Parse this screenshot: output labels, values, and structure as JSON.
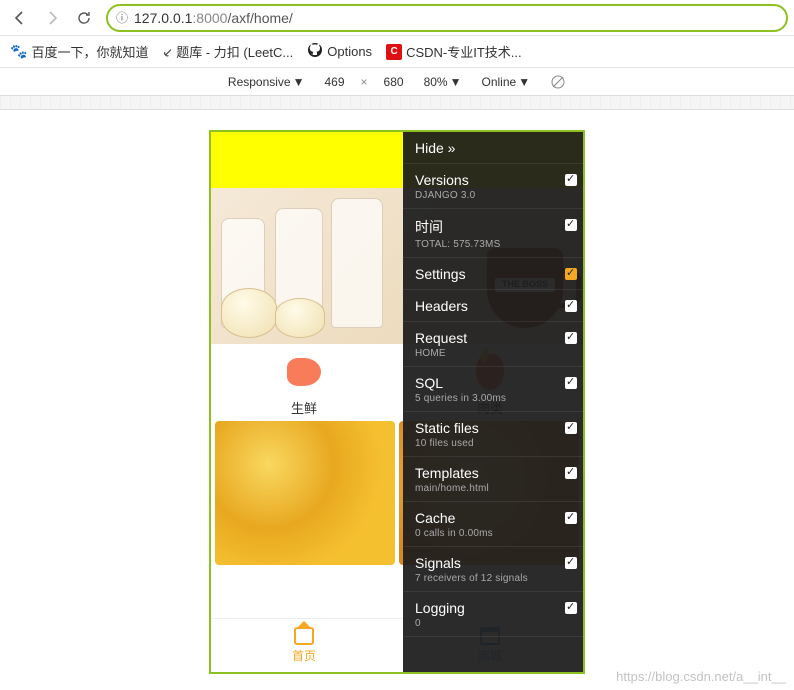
{
  "url": {
    "host": "127.0.0.1",
    "port": ":8000",
    "path": "/axf/home/"
  },
  "bookmarks": [
    {
      "label": "百度一下，你就知道"
    },
    {
      "label": "题库 - 力扣 (LeetC..."
    },
    {
      "label": "Options"
    },
    {
      "label": "CSDN-专业IT技术..."
    }
  ],
  "devtools": {
    "mode": "Responsive",
    "width": "469",
    "sep": "×",
    "height": "680",
    "zoom": "80%",
    "network": "Online"
  },
  "phone": {
    "cup_label": "THE BOSS",
    "categories": [
      {
        "label": "生鲜"
      },
      {
        "label": "肉类"
      }
    ],
    "nav": [
      {
        "label": "首页"
      },
      {
        "label": "商城"
      }
    ]
  },
  "debug": [
    {
      "title": "Hide »",
      "sub": "",
      "chk": false
    },
    {
      "title": "Versions",
      "sub": "Django 3.0",
      "chk": true
    },
    {
      "title": "时间",
      "sub": "Total: 575.73ms",
      "chk": true
    },
    {
      "title": "Settings",
      "sub": "",
      "chk": true,
      "orange": true
    },
    {
      "title": "Headers",
      "sub": "",
      "chk": true
    },
    {
      "title": "Request",
      "sub": "home",
      "chk": true
    },
    {
      "title": "SQL",
      "sub": "5 queries in 3.00ms",
      "chk": true
    },
    {
      "title": "Static files",
      "sub": "10 files used",
      "chk": true
    },
    {
      "title": "Templates",
      "sub": "main/home.html",
      "chk": true
    },
    {
      "title": "Cache",
      "sub": "0 calls in 0.00ms",
      "chk": true
    },
    {
      "title": "Signals",
      "sub": "7 receivers of 12 signals",
      "chk": true
    },
    {
      "title": "Logging",
      "sub": "0",
      "chk": true
    }
  ],
  "watermark": "https://blog.csdn.net/a__int__"
}
